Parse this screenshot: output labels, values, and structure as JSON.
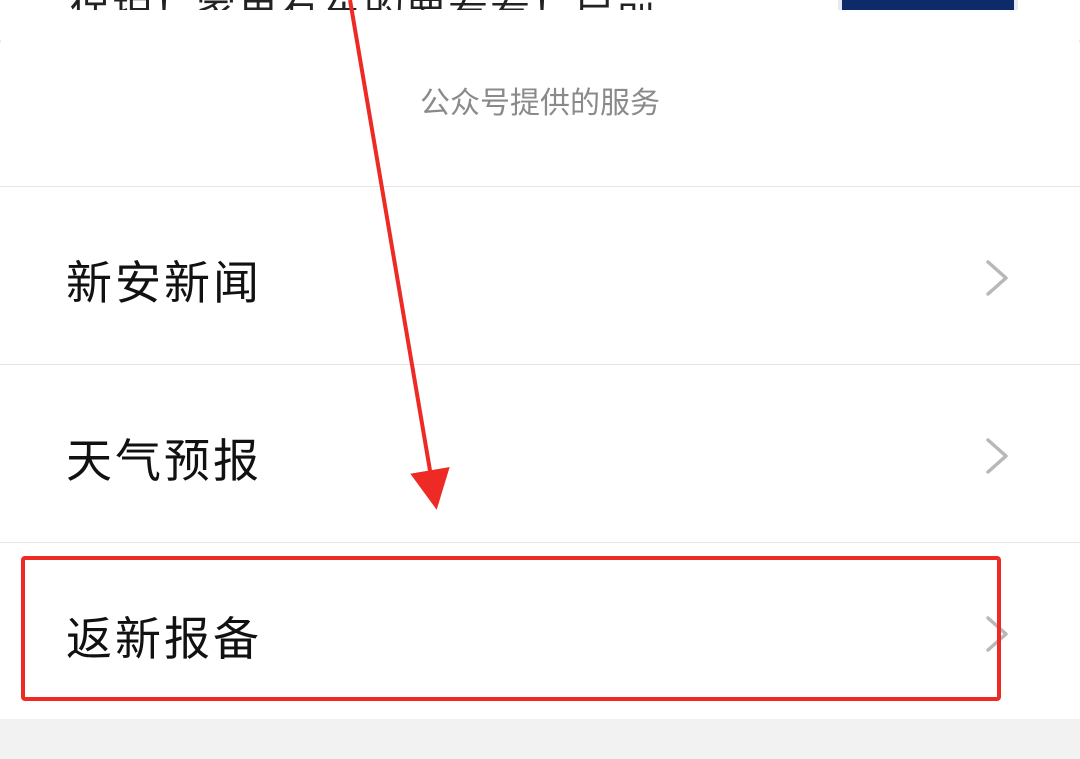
{
  "background": {
    "article_text": "保护！家里有车的要看看！启前"
  },
  "sheet": {
    "title": "公众号提供的服务",
    "items": [
      {
        "label": "新安新闻"
      },
      {
        "label": "天气预报"
      },
      {
        "label": "返新报备"
      }
    ]
  },
  "colors": {
    "annotation": "#ee2a24",
    "title_text": "#8a8a8a",
    "label_text": "#111111",
    "chevron": "#b8b8b8"
  },
  "icons": {
    "chevron": "chevron-right-icon",
    "arrow": "arrow-annotation",
    "highlight": "highlight-box"
  }
}
